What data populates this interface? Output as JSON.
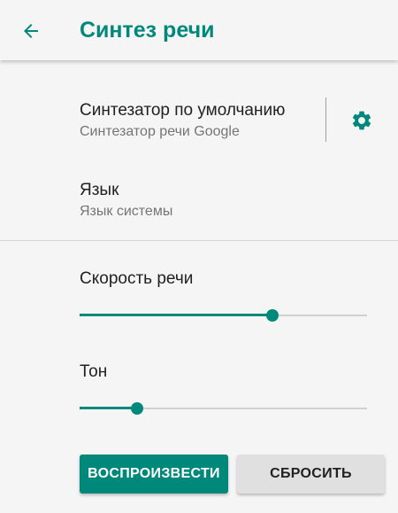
{
  "appbar": {
    "title": "Синтез речи",
    "back_icon": "arrow-left-icon"
  },
  "engine": {
    "title": "Синтезатор по умолчанию",
    "summary": "Синтезатор речи Google",
    "settings_icon": "gear-icon"
  },
  "language": {
    "title": "Язык",
    "summary": "Язык системы"
  },
  "speech_rate": {
    "label": "Скорость речи",
    "value_fraction": 0.67
  },
  "pitch": {
    "label": "Тон",
    "value_fraction": 0.2
  },
  "buttons": {
    "play": "ВОСПРОИЗВЕСТИ",
    "reset": "СБРОСИТЬ"
  },
  "colors": {
    "accent": "#00897b",
    "background": "#f5f5f5",
    "secondary_button": "#e0e0e0"
  }
}
